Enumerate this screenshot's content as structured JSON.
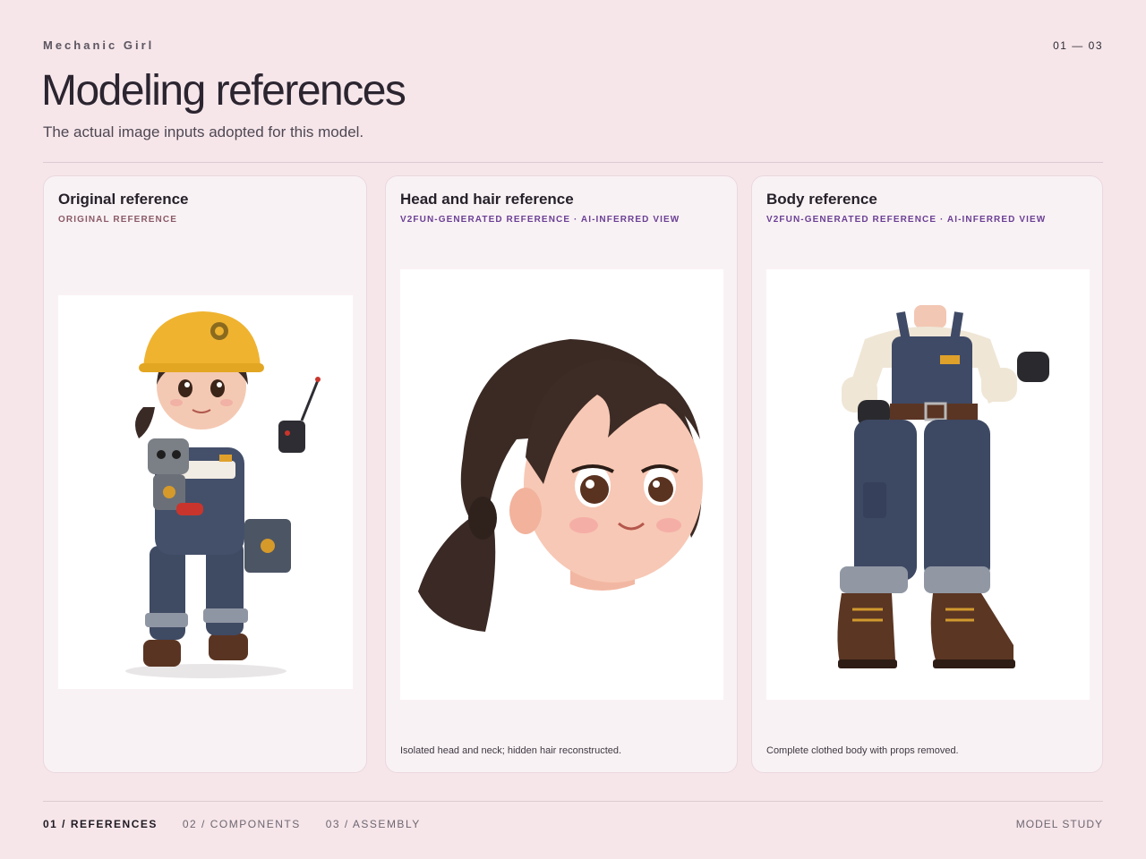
{
  "header": {
    "eyebrow": "Mechanic Girl",
    "counter": "01 — 03",
    "title": "Modeling references",
    "subtitle": "The actual image inputs adopted for this model."
  },
  "cards": [
    {
      "title": "Original reference",
      "tag": "ORIGINAL REFERENCE",
      "caption": ""
    },
    {
      "title": "Head and hair reference",
      "tag": "V2FUN-GENERATED REFERENCE · AI-INFERRED VIEW",
      "caption": "Isolated head and neck; hidden hair reconstructed."
    },
    {
      "title": "Body reference",
      "tag": "V2FUN-GENERATED REFERENCE · AI-INFERRED VIEW",
      "caption": "Complete clothed body with props removed."
    }
  ],
  "footer": {
    "nav": [
      "01 / REFERENCES",
      "02 / COMPONENTS",
      "03 / ASSEMBLY"
    ],
    "active_index": 0,
    "label": "MODEL STUDY"
  },
  "colors": {
    "background": "#f6e6ea",
    "card": "#f9f2f4",
    "tag_original": "#8a5a68",
    "tag_generated": "#6a3f95"
  }
}
